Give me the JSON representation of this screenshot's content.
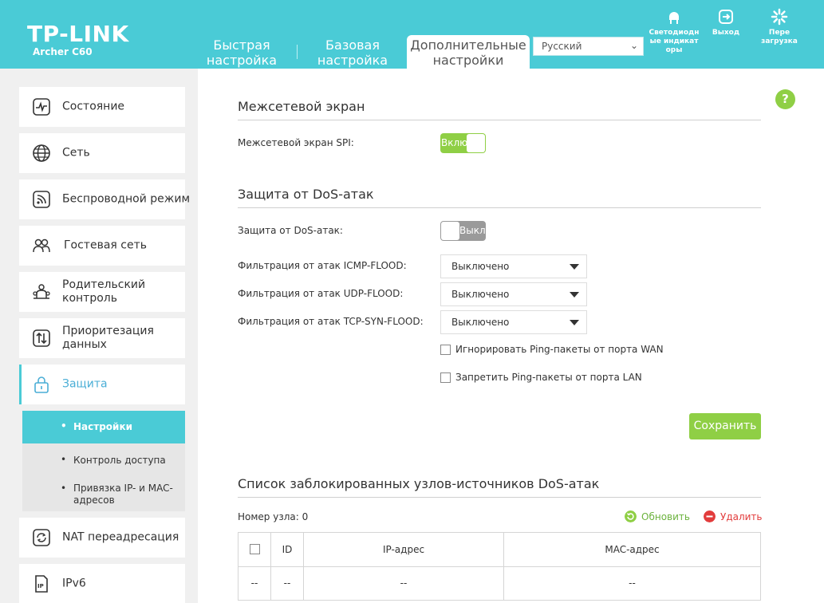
{
  "header": {
    "logo": "TP-LINK",
    "model": "Archer C60",
    "tabs": [
      {
        "line1": "Быстрая",
        "line2": "настройка"
      },
      {
        "line1": "Базовая",
        "line2": "настройка"
      },
      {
        "line1": "Дополнительные",
        "line2": "настройки"
      }
    ],
    "language": "Русский",
    "led_label_1": "Светодиодн",
    "led_label_2": "ые индикат",
    "led_label_3": "оры",
    "logout_label": "Выход",
    "reboot_label_1": "Пере",
    "reboot_label_2": "загрузка"
  },
  "sidebar": {
    "items": [
      {
        "label": "Состояние",
        "icon": "status-icon"
      },
      {
        "label": "Сеть",
        "icon": "globe-icon"
      },
      {
        "label": "Беспроводной режим",
        "icon": "wireless-icon"
      },
      {
        "label": "Гостевая сеть",
        "icon": "guest-icon"
      },
      {
        "label": "Родительский",
        "label2": "контроль",
        "icon": "parental-icon"
      },
      {
        "label": "Приоритезация",
        "label2": "данных",
        "icon": "qos-icon"
      },
      {
        "label": "Защита",
        "icon": "lock-icon"
      },
      {
        "label": "NAT переадресация",
        "icon": "nat-icon"
      },
      {
        "label": "IPv6",
        "icon": "ipv6-icon"
      }
    ],
    "sub_items": [
      {
        "label": "Настройки"
      },
      {
        "label": "Контроль доступа"
      },
      {
        "label": "Привязка IP- и MAC-",
        "label2": "адресов"
      }
    ]
  },
  "firewall": {
    "title": "Межсетевой экран",
    "spi_label": "Межсетевой экран SPI:",
    "spi_state": "Вклю"
  },
  "dos": {
    "title": "Защита от DoS-атак",
    "protection_label": "Защита от DoS-атак:",
    "protection_state": "Выкл",
    "icmp_label": "Фильтрация от атак ICMP-FLOOD:",
    "icmp_value": "Выключено",
    "udp_label": "Фильтрация от атак UDP-FLOOD:",
    "udp_value": "Выключено",
    "tcp_label": "Фильтрация от атак TCP-SYN-FLOOD:",
    "tcp_value": "Выключено",
    "ping_wan_label": "Игнорировать Ping-пакеты от порта WAN",
    "ping_lan_label": "Запретить Ping-пакеты от порта LAN",
    "save_label": "Сохранить"
  },
  "blocked": {
    "title": "Список заблокированных узлов-источников DoS-атак",
    "node_count": "Номер узла: 0",
    "refresh_label": "Обновить",
    "delete_label": "Удалить",
    "columns": [
      "ID",
      "IP-адрес",
      "MAC-адрес"
    ],
    "row": [
      "--",
      "--",
      "--",
      "--"
    ]
  },
  "colors": {
    "accent": "#4acbd6",
    "green": "#8fcf45",
    "red": "#e23c3c"
  }
}
